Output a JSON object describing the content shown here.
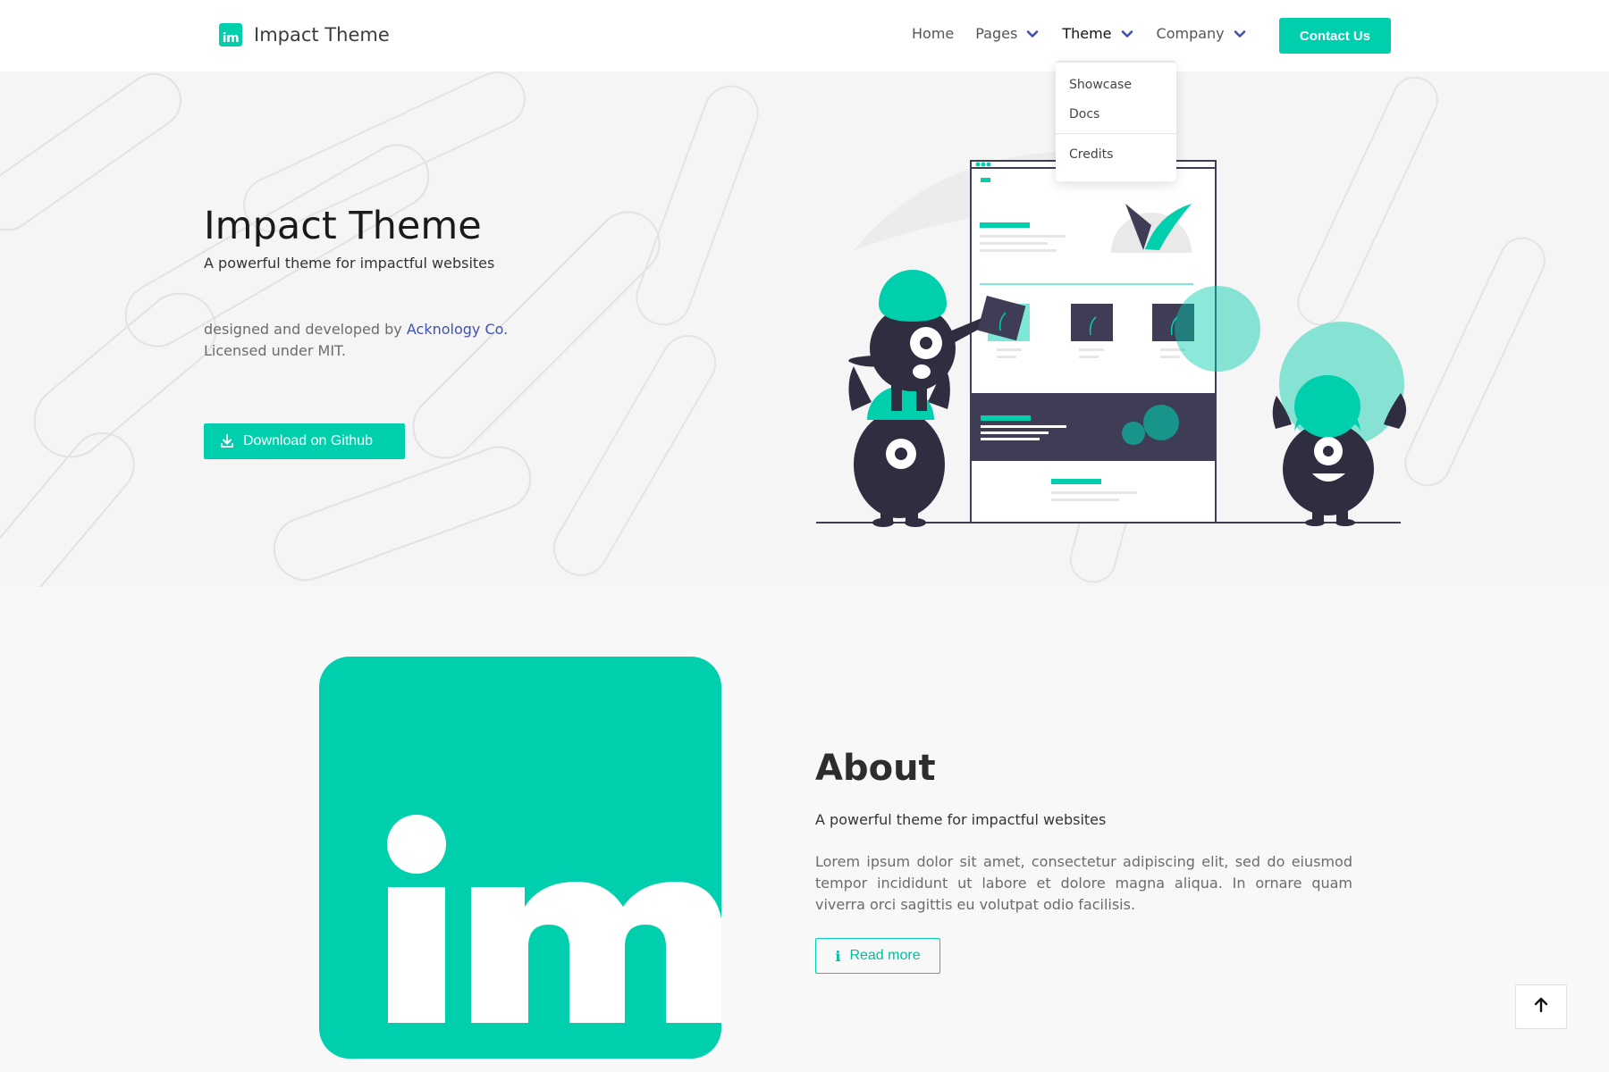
{
  "brand": {
    "logo_text": "im",
    "name": "Impact Theme"
  },
  "nav": {
    "items": [
      {
        "label": "Home",
        "has_dropdown": false
      },
      {
        "label": "Pages",
        "has_dropdown": true
      },
      {
        "label": "Theme",
        "has_dropdown": true,
        "active": true
      },
      {
        "label": "Company",
        "has_dropdown": true
      }
    ],
    "contact_label": "Contact Us",
    "theme_dropdown": {
      "items": [
        "Showcase",
        "Docs"
      ],
      "secondary_items": [
        "Credits"
      ]
    }
  },
  "hero": {
    "title": "Impact Theme",
    "subtitle": "A powerful theme for impactful websites",
    "credit_prefix": "designed and developed by",
    "credit_link": "Acknology Co.",
    "license": "Licensed under MIT.",
    "download_label": "Download on Github"
  },
  "about": {
    "logo_text": "im",
    "heading": "About",
    "subtitle": "A powerful theme for impactful websites",
    "text": "Lorem ipsum dolor sit amet, consectetur adipiscing elit, sed do eiusmod tempor incididunt ut labore et dolore magna aliqua. In ornare quam viverra orci sagittis eu volutpat odio facilisis.",
    "read_more_label": "Read more"
  },
  "colors": {
    "accent": "#00cfae",
    "dark": "#2f2e41",
    "link": "#3f51b5"
  },
  "icons": {
    "download": "download-icon",
    "info": "info-icon",
    "back_to_top": "arrow-up-icon",
    "dropdown": "chevron-down-icon"
  }
}
